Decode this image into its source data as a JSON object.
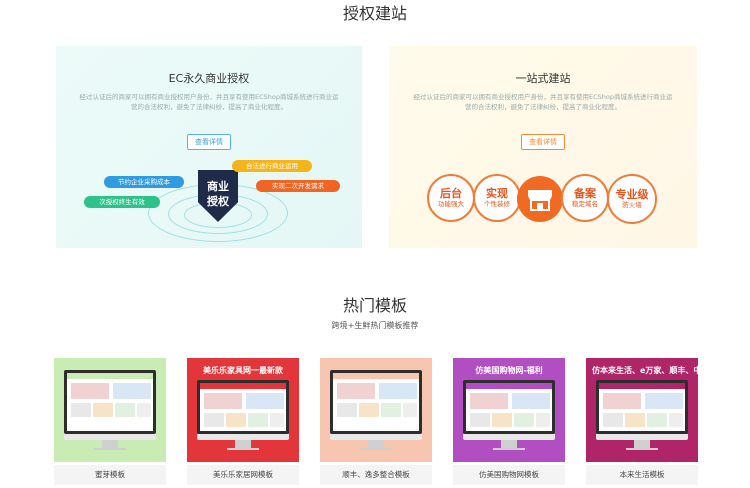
{
  "section1": {
    "title": "授权建站",
    "left_card": {
      "title": "EC永久商业授权",
      "desc": "经过认证后的商家可以拥有商业授权用户身份，并且享有使用ECShop商城系统进行商业运营的合法权利，避免了法律纠纷，提高了商业化程度。",
      "button": "查看详情",
      "shield_text": "商业\n授权",
      "tags": [
        "节约企业采购成本",
        "次授权终生有效",
        "合法进行商业运用",
        "实现二次开发需求"
      ]
    },
    "right_card": {
      "title": "一站式建站",
      "desc": "经过认证后的商家可以拥有商业授权用户身份，并且享有使用ECShop商城系统进行商业运营的合法权利，避免了法律纠纷，提高了商业化程度。",
      "button": "查看详情",
      "features": [
        {
          "big": "后台",
          "small": "功能强大"
        },
        {
          "big": "实现",
          "small": "个性装修"
        },
        {
          "big": "备案",
          "small": "稳定域名"
        },
        {
          "big": "专业级",
          "small": "防火墙"
        }
      ]
    }
  },
  "section2": {
    "title": "热门模板",
    "subtitle": "跨境+生鲜热门模板推荐",
    "templates": [
      {
        "label": "蜜芽模板",
        "bg": "#c8ecb4",
        "banner": ""
      },
      {
        "label": "美乐乐家居网模板",
        "bg": "#e2363a",
        "banner": "美乐乐家具网一最新款"
      },
      {
        "label": "顺丰、逸多整合模板",
        "bg": "#f8c6b0",
        "banner": ""
      },
      {
        "label": "仿美国购物网模板",
        "bg": "#b14ec2",
        "banner": "仿美国购物网-福利"
      },
      {
        "label": "本来生活模板",
        "bg": "#b02468",
        "banner": "仿本来生活、e万家、顺丰、中粮"
      }
    ]
  },
  "colors": {
    "accent_blue": "#3aa0dc",
    "accent_orange": "#f07c3a",
    "pill_blue": "#2f9be0",
    "pill_green": "#2cc28a",
    "pill_yellow": "#f4b41a",
    "pill_orange": "#f06424",
    "shield": "#1f2b49"
  },
  "icons": [
    "shield-icon",
    "store-icon",
    "monitor-icon"
  ]
}
